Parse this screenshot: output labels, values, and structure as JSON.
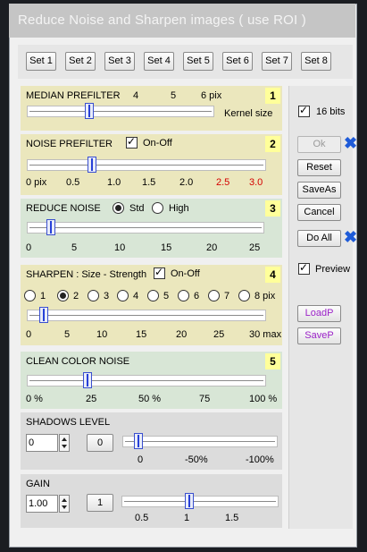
{
  "window": {
    "title": "Reduce Noise and Sharpen images   ( use ROI )"
  },
  "sets": [
    "Set 1",
    "Set 2",
    "Set 3",
    "Set 4",
    "Set 5",
    "Set 6",
    "Set 7",
    "Set 8"
  ],
  "median": {
    "title": "MEDIAN PREFILTER",
    "number": "1",
    "ticks": [
      "4",
      "5",
      "6 pix"
    ],
    "unit_label": "Kernel size",
    "value_fraction": 0.33
  },
  "noise": {
    "title": "NOISE PREFILTER",
    "number": "2",
    "toggle_label": "On-Off",
    "toggle_checked": true,
    "ticks": [
      "0 pix",
      "0.5",
      "1.0",
      "1.5",
      "2.0"
    ],
    "ticks_red": [
      "2.5",
      "3.0"
    ],
    "value_fraction": 0.27
  },
  "reduce": {
    "title": "REDUCE NOISE",
    "number": "3",
    "mode_std": "Std",
    "mode_high": "High",
    "mode_selected": "Std",
    "ticks": [
      "0",
      "5",
      "10",
      "15",
      "20",
      "25"
    ],
    "value": 3
  },
  "sharpen": {
    "title": "SHARPEN : Size - Strength",
    "number": "4",
    "toggle_label": "On-Off",
    "toggle_checked": true,
    "sizes": [
      "1",
      "2",
      "3",
      "4",
      "5",
      "6",
      "7",
      "8 pix"
    ],
    "size_selected": "2",
    "ticks": [
      "0",
      "5",
      "10",
      "15",
      "20",
      "25",
      "30 max"
    ],
    "value": 2
  },
  "clean": {
    "title": "CLEAN COLOR NOISE",
    "number": "5",
    "ticks": [
      "0 %",
      "25",
      "50 %",
      "75",
      "100 %"
    ],
    "value_percent": 25
  },
  "shadows": {
    "title": "SHADOWS LEVEL",
    "input_value": "0",
    "reset_label": "0",
    "ticks": [
      "0",
      "-50%",
      "-100%"
    ],
    "value_fraction": 0.1
  },
  "gain": {
    "title": "GAIN",
    "input_value": "1.00",
    "reset_label": "1",
    "ticks": [
      "0.5",
      "1",
      "1.5"
    ],
    "value_fraction": 0.43
  },
  "side": {
    "bits_label": "16 bits",
    "bits_checked": true,
    "ok_label": "Ok",
    "reset_label": "Reset",
    "saveas_label": "SaveAs",
    "cancel_label": "Cancel",
    "doall_label": "Do All",
    "preview_label": "Preview",
    "preview_checked": true,
    "loadp_label": "LoadP",
    "savep_label": "SaveP"
  }
}
